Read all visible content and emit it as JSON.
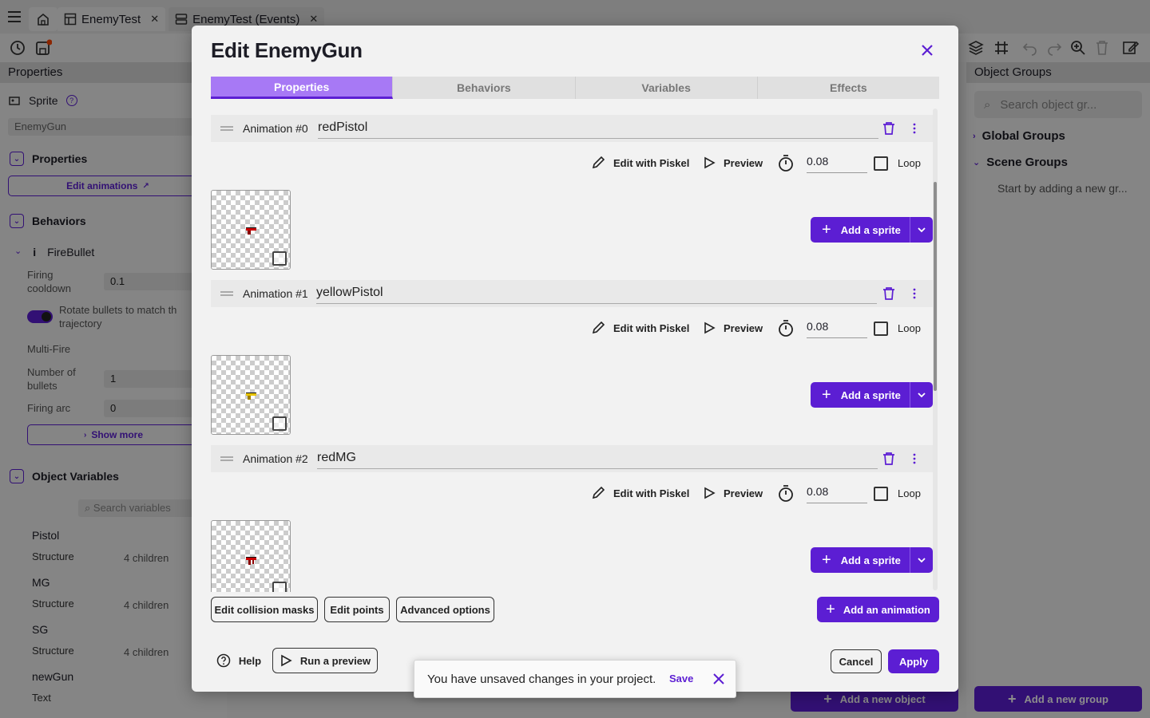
{
  "tabs_bar": {
    "tabs": [
      {
        "label": "EnemyTest"
      },
      {
        "label": "EnemyTest (Events)"
      }
    ]
  },
  "left_panel": {
    "header": "Properties",
    "object_type": "Sprite",
    "object_name": "EnemyGun",
    "properties_section": "Properties",
    "edit_animations": "Edit animations",
    "behaviors_section": "Behaviors",
    "behavior_name": "FireBullet",
    "firing_cooldown_label": "Firing cooldown",
    "firing_cooldown_value": "0.1",
    "rotate_label": "Rotate bullets to match th trajectory",
    "multi_fire": "Multi-Fire",
    "num_bullets_label": "Number of bullets",
    "num_bullets_value": "1",
    "firing_arc_label": "Firing arc",
    "firing_arc_value": "0",
    "show_more": "Show more",
    "object_variables_section": "Object Variables",
    "search_variables": "Search variables",
    "variables": [
      {
        "name": "Pistol",
        "type": "Structure",
        "info": "4 children"
      },
      {
        "name": "MG",
        "type": "Structure",
        "info": "4 children"
      },
      {
        "name": "SG",
        "type": "Structure",
        "info": "4 children"
      },
      {
        "name": "newGun",
        "type": "Text",
        "info": ""
      }
    ]
  },
  "right_panel": {
    "header": "Object Groups",
    "search_placeholder": "Search object gr...",
    "global_groups": "Global Groups",
    "scene_groups": "Scene Groups",
    "empty_hint": "Start by adding a new gr...",
    "add_group": "Add a new group",
    "add_object": "Add a new object"
  },
  "modal": {
    "title": "Edit EnemyGun",
    "tabs": [
      "Properties",
      "Behaviors",
      "Variables",
      "Effects"
    ],
    "animations": [
      {
        "label": "Animation #0",
        "name": "redPistol",
        "duration": "0.08"
      },
      {
        "label": "Animation #1",
        "name": "yellowPistol",
        "duration": "0.08"
      },
      {
        "label": "Animation #2",
        "name": "redMG",
        "duration": "0.08"
      }
    ],
    "edit_with_piskel": "Edit with Piskel",
    "preview": "Preview",
    "loop": "Loop",
    "add_sprite": "Add a sprite",
    "edit_collision_masks": "Edit collision masks",
    "edit_points": "Edit points",
    "advanced_options": "Advanced options",
    "add_animation": "Add an animation",
    "help": "Help",
    "run_preview": "Run a preview",
    "cancel": "Cancel",
    "apply": "Apply"
  },
  "snackbar": {
    "message": "You have unsaved changes in your project.",
    "save": "Save"
  },
  "colors": {
    "accent": "#5c1ed3",
    "tab_active": "#a779f5"
  }
}
